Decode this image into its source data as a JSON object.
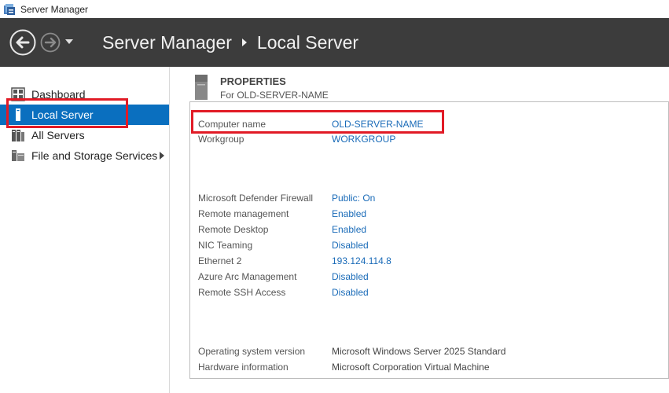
{
  "window": {
    "title": "Server Manager",
    "icon": "server-manager-icon"
  },
  "header": {
    "breadcrumb_root": "Server Manager",
    "breadcrumb_current": "Local Server",
    "background": "#3c3c3c"
  },
  "sidebar": {
    "items": [
      {
        "label": "Dashboard",
        "icon": "dashboard-grid-icon"
      },
      {
        "label": "Local Server",
        "icon": "local-server-icon",
        "active": true
      },
      {
        "label": "All Servers",
        "icon": "all-servers-icon"
      },
      {
        "label": "File and Storage Services",
        "icon": "file-storage-icon",
        "has_submenu": true
      }
    ],
    "active_color": "#0a6fbf"
  },
  "properties": {
    "title": "PROPERTIES",
    "subtitle": "For OLD-SERVER-NAME",
    "rows_top": [
      {
        "label": "Computer name",
        "value": "OLD-SERVER-NAME",
        "link": true
      },
      {
        "label": "Workgroup",
        "value": "WORKGROUP",
        "link": true
      }
    ],
    "rows_mid": [
      {
        "label": "Microsoft Defender Firewall",
        "value": "Public: On",
        "link": true
      },
      {
        "label": "Remote management",
        "value": "Enabled",
        "link": true
      },
      {
        "label": "Remote Desktop",
        "value": "Enabled",
        "link": true
      },
      {
        "label": "NIC Teaming",
        "value": "Disabled",
        "link": true
      },
      {
        "label": "Ethernet 2",
        "value": "193.124.114.8",
        "link": true
      },
      {
        "label": "Azure Arc Management",
        "value": "Disabled",
        "link": true
      },
      {
        "label": "Remote SSH Access",
        "value": "Disabled",
        "link": true
      }
    ],
    "rows_bottom": [
      {
        "label": "Operating system version",
        "value": "Microsoft Windows Server 2025 Standard",
        "link": false
      },
      {
        "label": "Hardware information",
        "value": "Microsoft Corporation Virtual Machine",
        "link": false
      }
    ]
  },
  "colors": {
    "link": "#1a6bb8",
    "highlight": "#e11b26"
  }
}
